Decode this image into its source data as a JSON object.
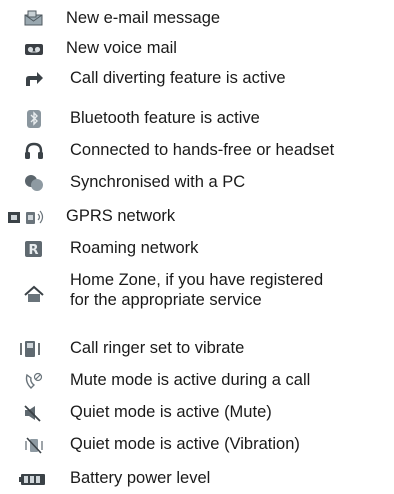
{
  "items": [
    {
      "icon": "email-icon",
      "label": "New e-mail message"
    },
    {
      "icon": "voicemail-icon",
      "label": "New voice mail"
    },
    {
      "icon": "call-divert-icon",
      "label": "Call diverting feature is active"
    },
    {
      "icon": "bluetooth-icon",
      "label": "Bluetooth feature is active"
    },
    {
      "icon": "headset-icon",
      "label": "Connected to hands-free or headset"
    },
    {
      "icon": "sync-pc-icon",
      "label": "Synchronised with a PC"
    },
    {
      "icon": "gprs-icon",
      "label": "GPRS network"
    },
    {
      "icon": "roaming-icon",
      "label": "Roaming network"
    },
    {
      "icon": "home-zone-icon",
      "label_line1": "Home Zone, if you have registered",
      "label_line2": "for the appropriate service"
    },
    {
      "icon": "vibrate-icon",
      "label": "Call ringer set to vibrate"
    },
    {
      "icon": "mute-call-icon",
      "label": "Mute mode is active during a call"
    },
    {
      "icon": "quiet-mute-icon",
      "label": "Quiet mode is active (Mute)"
    },
    {
      "icon": "quiet-vibration-icon",
      "label": "Quiet mode is active (Vibration)"
    },
    {
      "icon": "battery-icon",
      "label": "Battery power level"
    }
  ]
}
